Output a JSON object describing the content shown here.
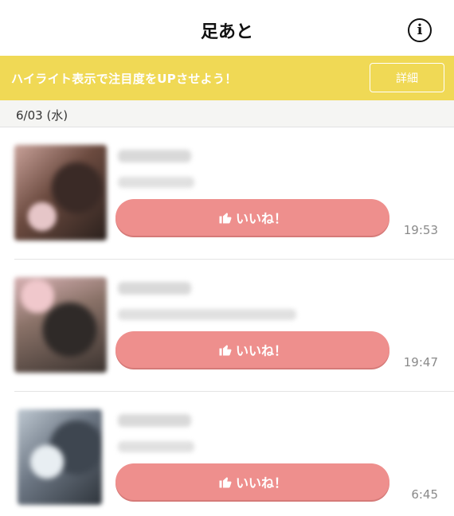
{
  "header": {
    "title": "足あと",
    "info_icon": "info-icon"
  },
  "banner": {
    "text": "ハイライト表示で注目度をUPさせよう！",
    "detail_label": "詳細",
    "color": "#f0d955"
  },
  "date_section": {
    "label": "6/03 (水)"
  },
  "footprints": [
    {
      "like_label": "いいね！",
      "time": "19:53"
    },
    {
      "like_label": "いいね！",
      "time": "19:47"
    },
    {
      "like_label": "いいね！",
      "time": "6:45"
    }
  ],
  "colors": {
    "like_button": "#ee8f8d",
    "time_text": "#8a8a8a"
  }
}
